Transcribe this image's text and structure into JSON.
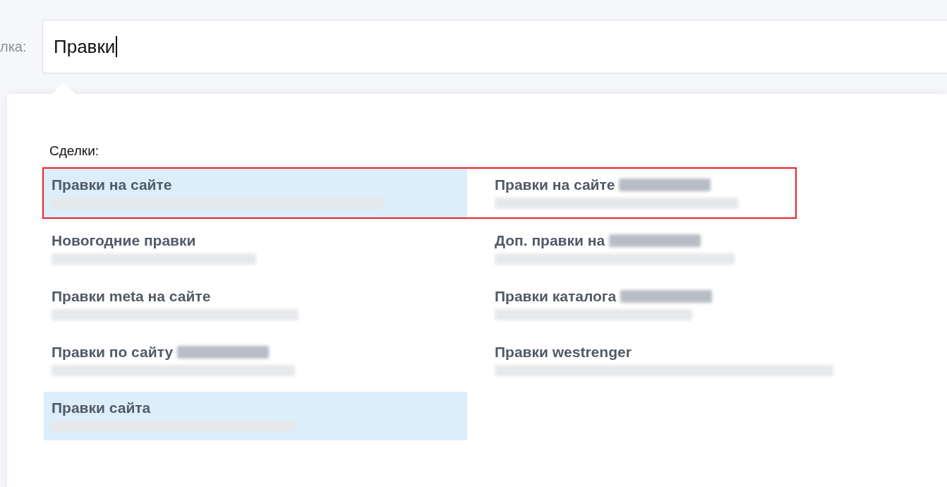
{
  "search": {
    "label": "лка:",
    "value": "Правки"
  },
  "dropdown": {
    "heading": "Сделки:",
    "rows": [
      {
        "outlined": true,
        "items": [
          {
            "title": "Правки на сайте",
            "title_redacted": false,
            "selected": true
          },
          {
            "title": "Правки на сайте",
            "title_redacted": true,
            "selected": false
          }
        ]
      },
      {
        "outlined": false,
        "items": [
          {
            "title": "Новогодние правки",
            "title_redacted": false,
            "selected": false
          },
          {
            "title": "Доп. правки на",
            "title_redacted": true,
            "selected": false
          }
        ]
      },
      {
        "outlined": false,
        "items": [
          {
            "title": "Правки meta на сайте",
            "title_redacted": false,
            "selected": false
          },
          {
            "title": "Правки каталога",
            "title_redacted": true,
            "selected": false
          }
        ]
      },
      {
        "outlined": false,
        "items": [
          {
            "title": "Правки по сайту",
            "title_redacted": true,
            "selected": false
          },
          {
            "title": "Правки westrenger",
            "title_redacted": false,
            "selected": false
          }
        ]
      },
      {
        "outlined": false,
        "items": [
          {
            "title": "Правки сайта",
            "title_redacted": false,
            "selected": true
          }
        ]
      }
    ]
  }
}
